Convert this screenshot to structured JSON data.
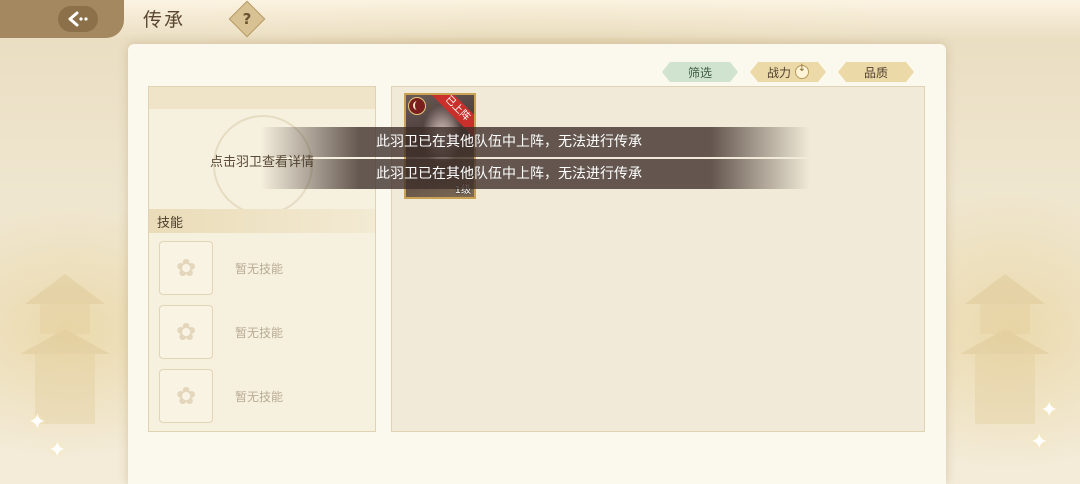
{
  "header": {
    "title": "传承",
    "help_symbol": "?"
  },
  "sort_bar": {
    "filter_label": "筛选",
    "power_label": "战力",
    "quality_label": "品质"
  },
  "detail": {
    "tip": "点击羽卫查看详情",
    "skill_header": "技能",
    "skills": [
      "暂无技能",
      "暂无技能",
      "暂无技能"
    ]
  },
  "roster": {
    "cards": [
      {
        "status_ribbon": "已上阵",
        "level": "1级"
      }
    ]
  },
  "toasts": [
    "此羽卫已在其他队伍中上阵，无法进行传承",
    "此羽卫已在其他队伍中上阵，无法进行传承"
  ],
  "colors": {
    "accent_green": "#cfe3cf",
    "accent_gold": "#ecd9a8",
    "ribbon_red": "#c9302b"
  }
}
